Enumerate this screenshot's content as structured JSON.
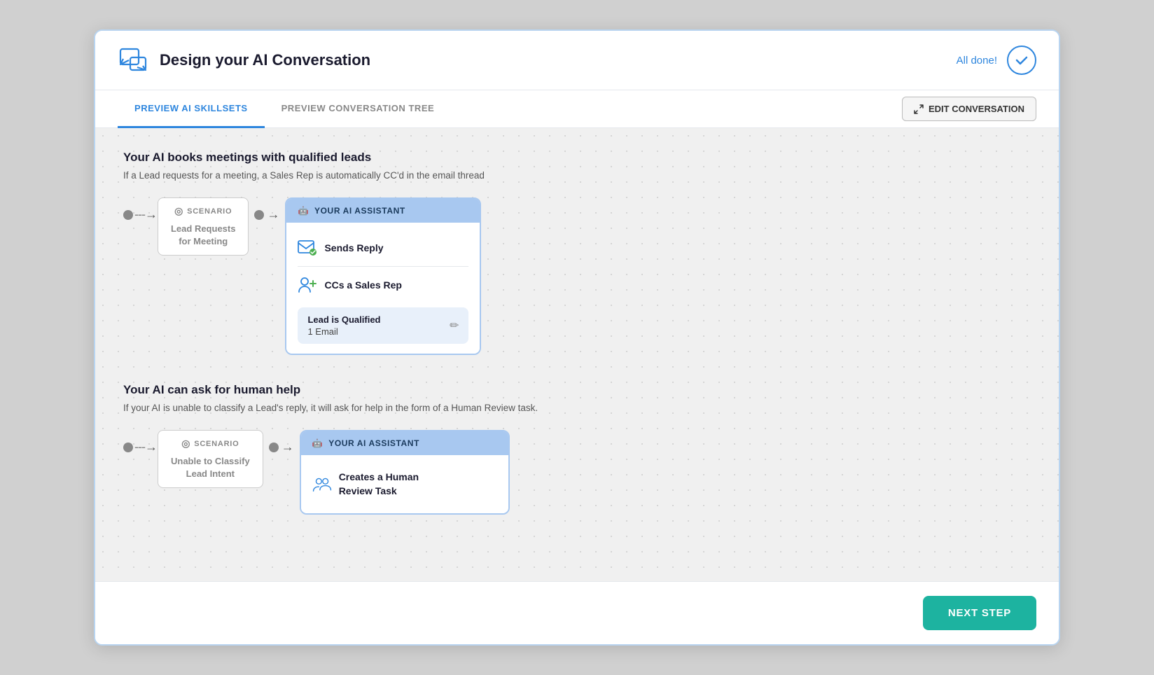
{
  "header": {
    "title": "Design your AI Conversation",
    "all_done_label": "All done!",
    "icon_alt": "conversation-icon"
  },
  "tabs": {
    "items": [
      {
        "id": "preview-skillsets",
        "label": "PREVIEW AI SKILLSETS",
        "active": true
      },
      {
        "id": "preview-tree",
        "label": "PREVIEW CONVERSATION TREE",
        "active": false
      }
    ],
    "edit_button_label": "EDIT CONVERSATION"
  },
  "sections": [
    {
      "id": "meeting-section",
      "title": "Your AI books meetings with qualified leads",
      "description": "If a Lead requests for a meeting, a Sales Rep is automatically CC'd in the email thread",
      "flow": {
        "scenario_label": "SCENARIO",
        "scenario_value": "Lead Requests\nfor Meeting",
        "ai_header": "YOUR AI ASSISTANT",
        "actions": [
          {
            "id": "sends-reply",
            "label": "Sends Reply",
            "icon": "email-check-icon"
          },
          {
            "id": "ccs-rep",
            "label": "CCs a Sales Rep",
            "icon": "person-add-icon"
          }
        ],
        "card": {
          "title": "Lead is Qualified",
          "subtitle": "1 Email"
        }
      }
    },
    {
      "id": "human-help-section",
      "title": "Your AI can ask for human help",
      "description": "If your AI is unable to classify a Lead's reply, it will ask for help in the form of a Human Review task.",
      "flow": {
        "scenario_label": "SCENARIO",
        "scenario_value": "Unable to Classify\nLead Intent",
        "ai_header": "YOUR AI ASSISTANT",
        "actions": [
          {
            "id": "creates-task",
            "label": "Creates a Human\nReview Task",
            "icon": "people-icon"
          }
        ]
      }
    }
  ],
  "footer": {
    "next_step_label": "NEXT STEP"
  }
}
